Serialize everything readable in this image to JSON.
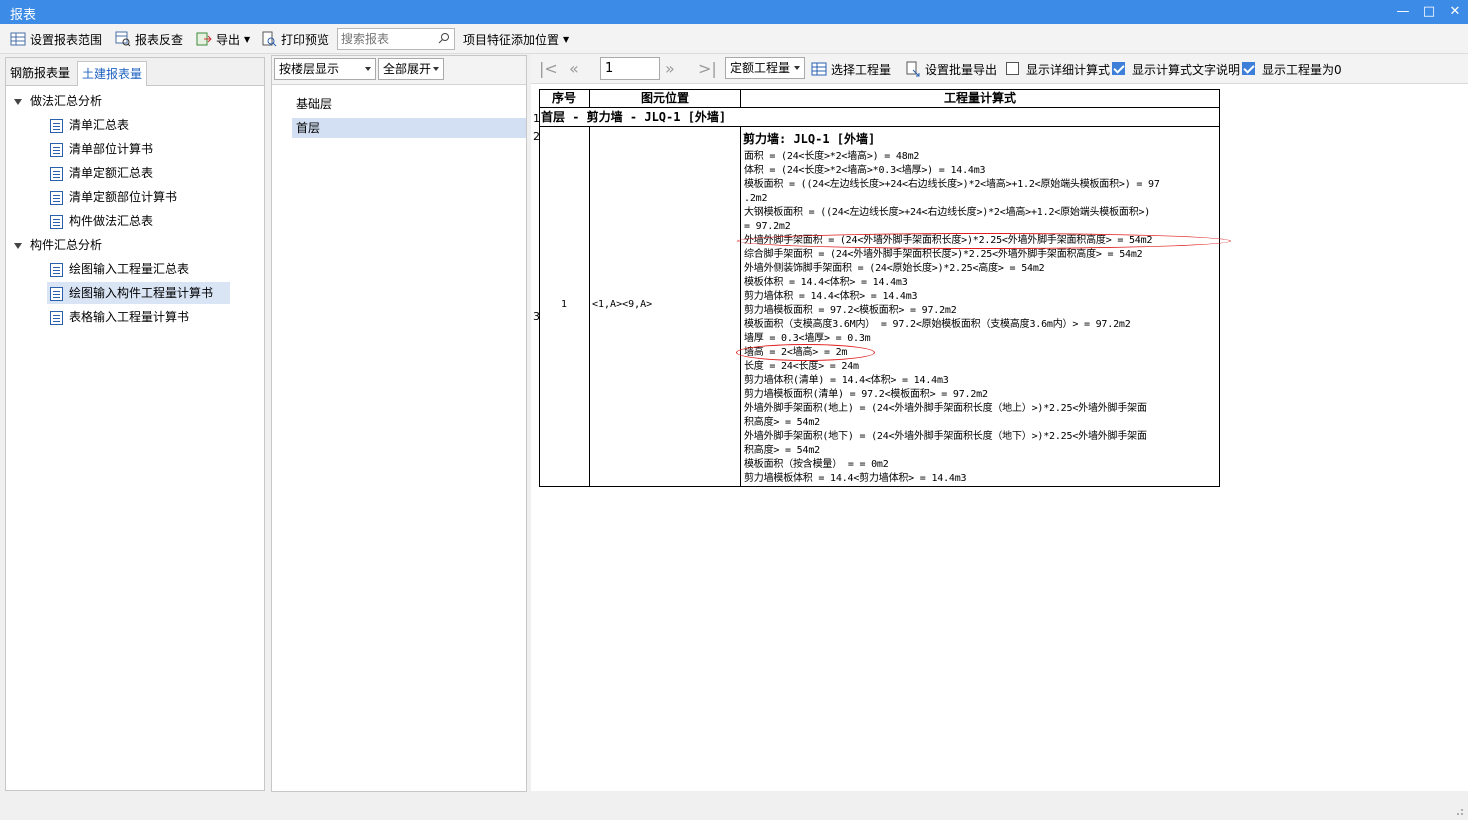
{
  "window": {
    "title": "报表",
    "controls": [
      "—",
      "□",
      "✕"
    ]
  },
  "toolbar": {
    "set_range": "设置报表范围",
    "reverse": "报表反查",
    "export": "导出",
    "print_preview": "打印预览",
    "search_placeholder": "搜索报表",
    "add_feature": "项目特征添加位置"
  },
  "left": {
    "tabs": [
      "钢筋报表量",
      "土建报表量"
    ],
    "active_tab": 1,
    "groups": [
      {
        "label": "做法汇总分析",
        "items": [
          "清单汇总表",
          "清单部位计算书",
          "清单定额汇总表",
          "清单定额部位计算书",
          "构件做法汇总表"
        ]
      },
      {
        "label": "构件汇总分析",
        "items": [
          "绘图输入工程量汇总表",
          "绘图输入构件工程量计算书",
          "表格输入工程量计算书"
        ]
      }
    ],
    "selected_item": "绘图输入构件工程量计算书"
  },
  "middle": {
    "display_mode": "按楼层显示",
    "expand_mode": "全部展开",
    "floors": [
      "基础层",
      "首层"
    ],
    "selected_floor": "首层"
  },
  "right_toolbar": {
    "page": "1",
    "quantity_type": "定额工程量",
    "select_quantity": "选择工程量",
    "batch_export": "设置批量导出",
    "show_detail": {
      "label": "显示详细计算式",
      "checked": false
    },
    "show_text_desc": {
      "label": "显示计算式文字说明",
      "checked": true
    },
    "show_zero": {
      "label": "显示工程量为0",
      "checked": true
    }
  },
  "report": {
    "headers": [
      "序号",
      "图元位置",
      "工程量计算式"
    ],
    "row_numbers": [
      "1",
      "2",
      "3"
    ],
    "group_title": "首层 - 剪力墙 - JLQ-1 [外墙]",
    "seq": "1",
    "location": "<1,A><9,A>",
    "component_title": "剪力墙: JLQ-1 [外墙]",
    "formulas": [
      "面积 = (24<长度>*2<墙高>) = 48m2",
      "体积 = (24<长度>*2<墙高>*0.3<墙厚>) = 14.4m3",
      "模板面积 = ((24<左边线长度>+24<右边线长度>)*2<墙高>+1.2<原始端头模板面积>) = 97",
      ".2m2",
      "大钢模板面积 = ((24<左边线长度>+24<右边线长度>)*2<墙高>+1.2<原始端头模板面积>)",
      "= 97.2m2",
      "外墙外脚手架面积 = (24<外墙外脚手架面积长度>)*2.25<外墙外脚手架面积高度> = 54m2",
      "综合脚手架面积 = (24<外墙外脚手架面积长度>)*2.25<外墙外脚手架面积高度> = 54m2",
      "外墙外侧装饰脚手架面积 = (24<原始长度>)*2.25<高度> = 54m2",
      "模板体积 = 14.4<体积> = 14.4m3",
      "剪力墙体积 = 14.4<体积> = 14.4m3",
      "剪力墙模板面积 = 97.2<模板面积> = 97.2m2",
      "模板面积（支模高度3.6M内） = 97.2<原始模板面积（支模高度3.6m内）> = 97.2m2",
      "墙厚 = 0.3<墙厚> = 0.3m",
      "墙高 = 2<墙高> = 2m",
      "长度 = 24<长度> = 24m",
      "剪力墙体积(清单) = 14.4<体积> = 14.4m3",
      "剪力墙模板面积(清单) = 97.2<模板面积> = 97.2m2",
      "外墙外脚手架面积(地上) = (24<外墙外脚手架面积长度（地上）>)*2.25<外墙外脚手架面",
      "积高度> = 54m2",
      "外墙外脚手架面积(地下) = (24<外墙外脚手架面积长度（地下）>)*2.25<外墙外脚手架面",
      "积高度> = 54m2",
      "模板面积（按含模量） =  = 0m2",
      "剪力墙模板体积 = 14.4<剪力墙体积> = 14.4m3"
    ]
  },
  "colors": {
    "titlebar": "#3c8be6",
    "accent": "#1e62c0",
    "highlight_ellipse": "#e02020",
    "selection": "#d9e4f5"
  }
}
